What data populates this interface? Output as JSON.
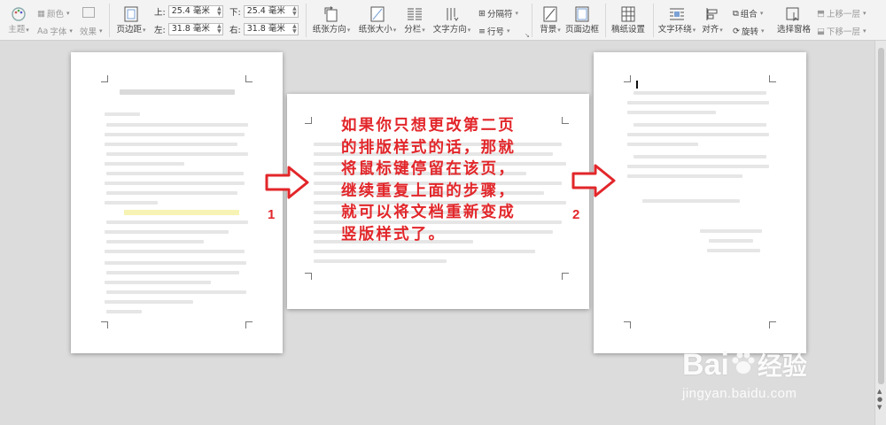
{
  "ribbon": {
    "theme": "主题",
    "color": "颜色",
    "font": "字体",
    "effect": "效果",
    "margins": "页边距",
    "margin_top_label": "上:",
    "margin_top_value": "25.4 毫米",
    "margin_bottom_label": "下:",
    "margin_bottom_value": "25.4 毫米",
    "margin_left_label": "左:",
    "margin_left_value": "31.8 毫米",
    "margin_right_label": "右:",
    "margin_right_value": "31.8 毫米",
    "orientation": "纸张方向",
    "paper_size": "纸张大小",
    "columns": "分栏",
    "text_direction": "文字方向",
    "separator": "分隔符",
    "line_number": "行号",
    "background": "背景",
    "page_border": "页面边框",
    "manuscript": "稿纸设置",
    "wrap_text": "文字环绕",
    "align": "对齐",
    "group": "组合",
    "rotate": "旋转",
    "selection_pane": "选择窗格",
    "bring_forward": "上移一层",
    "send_backward": "下移一层"
  },
  "annotation": {
    "callout": "如果你只想更改第二页的排版样式的话，那就将鼠标键停留在该页，继续重复上面的步骤，就可以将文档重新变成竖版样式了。",
    "label_1": "1",
    "label_2": "2"
  },
  "watermark": {
    "brand": "Bai",
    "brand_suffix": "经验",
    "url": "jingyan.baidu.com"
  },
  "colors": {
    "annotation_red": "#e2262a",
    "ribbon_bg": "#f3f3f3",
    "workspace_bg": "#dcdcdc"
  }
}
